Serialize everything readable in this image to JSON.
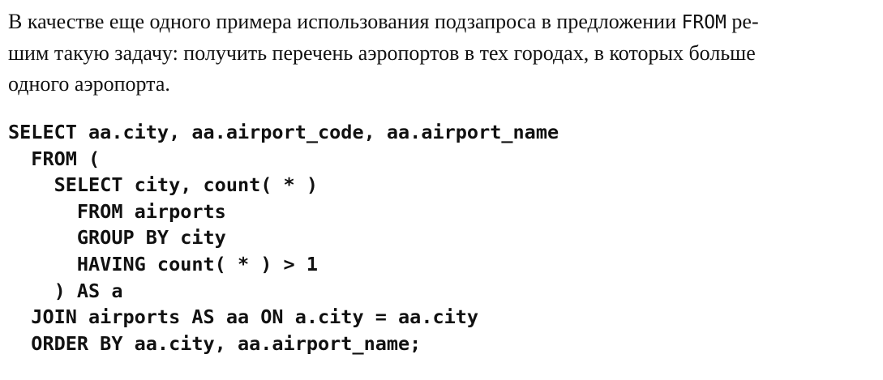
{
  "paragraph": {
    "line1_before": "В качестве еще одного примера использования подзапроса в предложении ",
    "line1_code": "FROM",
    "line1_after": " ре-",
    "line2": "шим такую задачу: получить перечень аэропортов в тех городах, в которых больше",
    "line3": "одного аэропорта."
  },
  "code": {
    "lines": [
      "SELECT aa.city, aa.airport_code, aa.airport_name",
      "  FROM (",
      "    SELECT city, count( * )",
      "      FROM airports",
      "      GROUP BY city",
      "      HAVING count( * ) > 1",
      "    ) AS a",
      "  JOIN airports AS aa ON a.city = aa.city",
      "  ORDER BY aa.city, aa.airport_name;"
    ]
  }
}
